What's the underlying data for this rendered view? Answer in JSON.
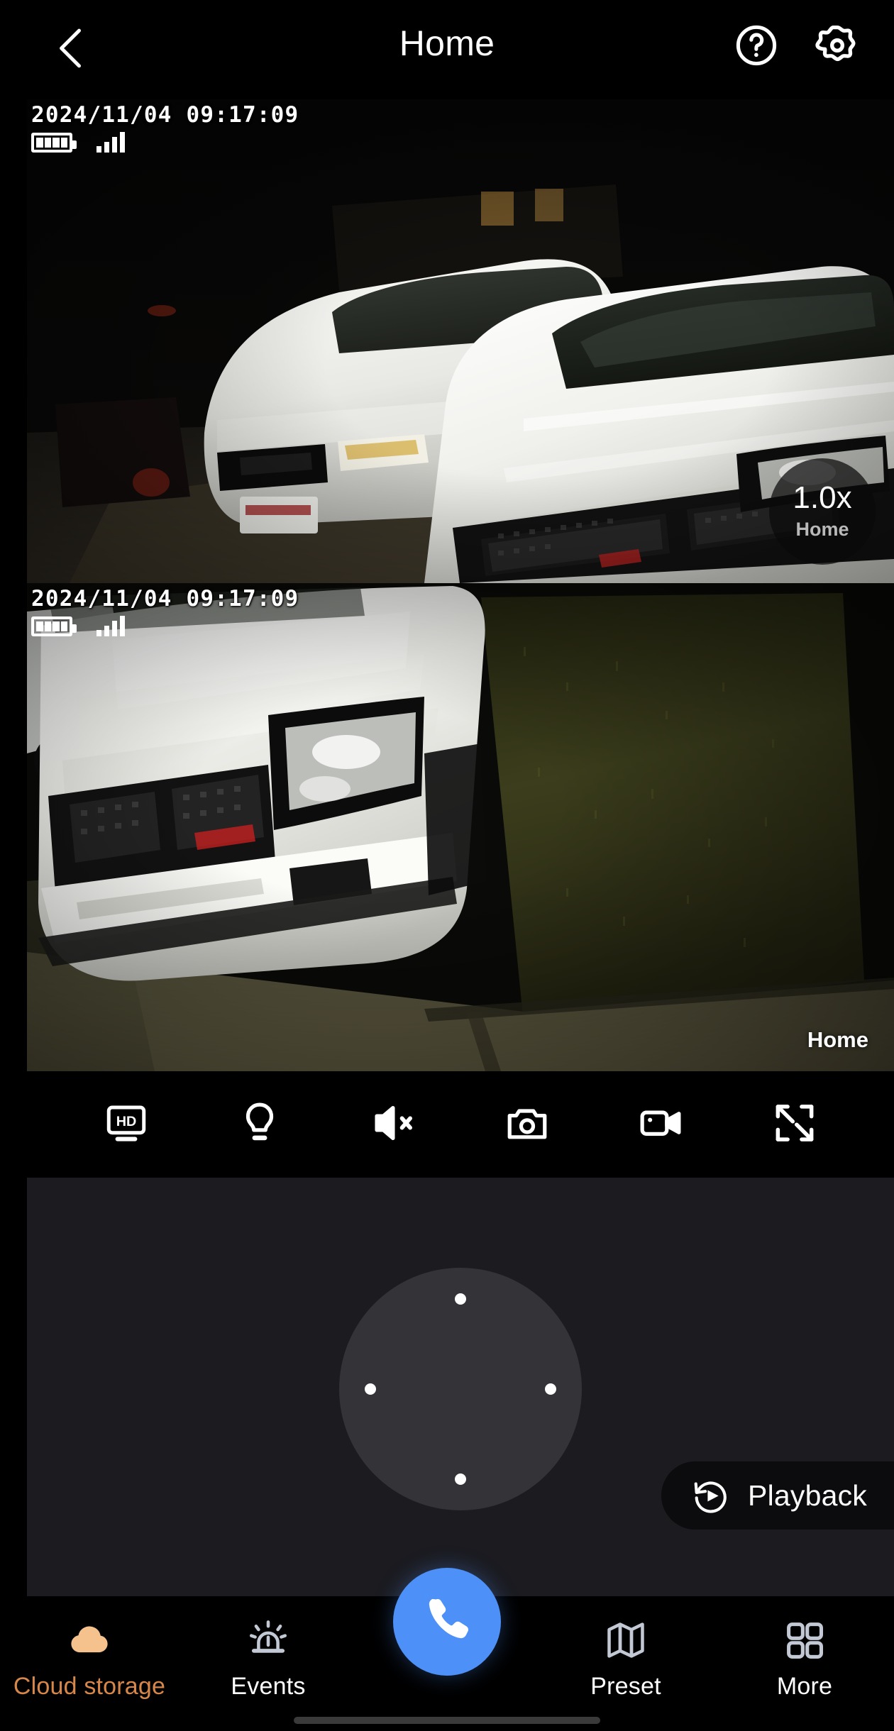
{
  "header": {
    "title": "Home",
    "back_icon": "chevron-left-icon",
    "help_icon": "help-circle-icon",
    "settings_icon": "gear-icon"
  },
  "video_panes": [
    {
      "id": "pane-primary",
      "timestamp": "2024/11/04 09:17:09",
      "battery_icon": "battery-full-icon",
      "battery_bars": 4,
      "signal_icon": "signal-bars-icon",
      "signal_bars": 4,
      "zoom_level": "1.0x",
      "camera_label": "Home",
      "scene": "night driveway with two white SUVs"
    },
    {
      "id": "pane-secondary",
      "timestamp": "2024/11/04 09:17:09",
      "battery_icon": "battery-full-icon",
      "battery_bars": 4,
      "signal_icon": "signal-bars-icon",
      "signal_bars": 4,
      "camera_label": "Home",
      "scene": "night close-up of white SUV front and lawn"
    }
  ],
  "toolbar": [
    {
      "name": "hd-quality-button",
      "icon": "hd-monitor-icon",
      "label": "HD"
    },
    {
      "name": "light-button",
      "icon": "light-bulb-icon",
      "label": "Light"
    },
    {
      "name": "mute-button",
      "icon": "speaker-muted-icon",
      "label": "Mute"
    },
    {
      "name": "snapshot-button",
      "icon": "camera-icon",
      "label": "Snapshot"
    },
    {
      "name": "record-button",
      "icon": "video-camera-icon",
      "label": "Record"
    },
    {
      "name": "fullscreen-button",
      "icon": "expand-arrows-icon",
      "label": "Fullscreen"
    }
  ],
  "ptz": {
    "name": "ptz-directional-pad",
    "directions": [
      "up",
      "right",
      "down",
      "left"
    ]
  },
  "playback": {
    "label": "Playback",
    "icon": "replay-play-icon"
  },
  "bottom_nav": [
    {
      "name": "cloud-storage",
      "label": "Cloud storage",
      "icon": "cloud-icon",
      "active": true
    },
    {
      "name": "events",
      "label": "Events",
      "icon": "alarm-siren-icon",
      "active": false
    },
    {
      "name": "preset",
      "label": "Preset",
      "icon": "map-fold-icon",
      "active": false
    },
    {
      "name": "more",
      "label": "More",
      "icon": "grid-2x2-icon",
      "active": false
    }
  ],
  "call_button": {
    "name": "talk-call-button",
    "icon": "phone-handset-icon"
  },
  "colors": {
    "background": "#000000",
    "panel": "#1b1b20",
    "ptz_pad": "#333338",
    "accent_blue": "#4d90f7",
    "accent_orange": "#d8874a",
    "cloud_icon": "#f5c28e",
    "nav_icon": "#c2c8d4"
  }
}
